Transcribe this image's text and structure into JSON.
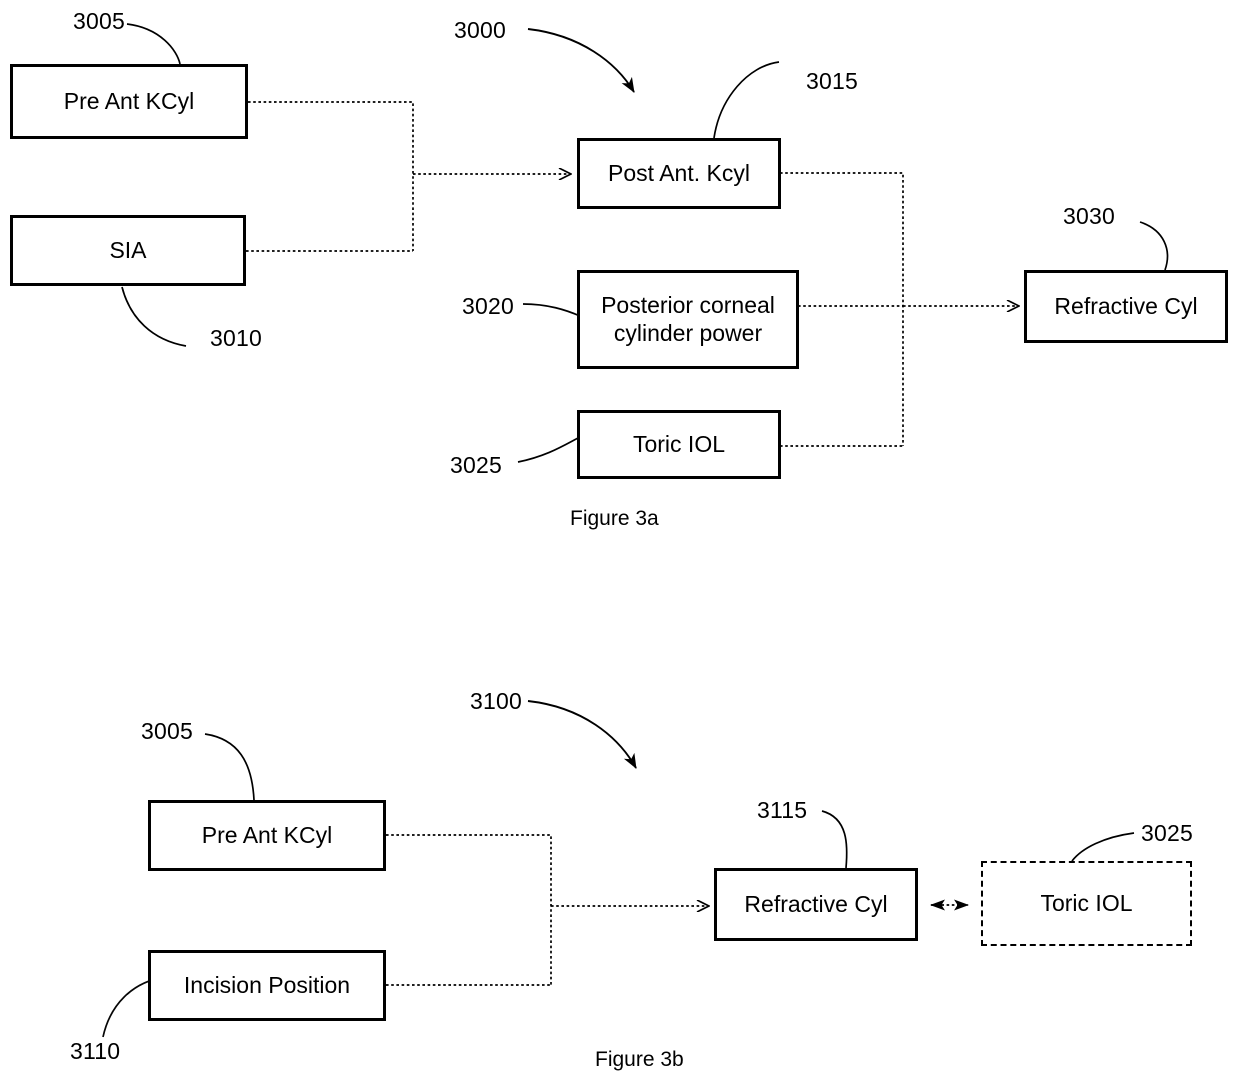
{
  "document": {
    "title": "Patent Figure 3a / 3b - Toric IOL refractive cylinder flow diagrams"
  },
  "figures": [
    {
      "id": "figure-3a",
      "caption": "Figure 3a",
      "overall_ref": "3000",
      "nodes": [
        {
          "id": "pre-ant-kcyl",
          "label": "Pre Ant KCyl",
          "ref": "3005",
          "style": "solid"
        },
        {
          "id": "sia",
          "label": "SIA",
          "ref": "3010",
          "style": "solid"
        },
        {
          "id": "post-ant-kcyl",
          "label": "Post Ant. Kcyl",
          "ref": "3015",
          "style": "solid"
        },
        {
          "id": "posterior-corneal-cylinder-power",
          "label": "Posterior corneal\ncylinder power",
          "ref": "3020",
          "style": "solid"
        },
        {
          "id": "toric-iol",
          "label": "Toric IOL",
          "ref": "3025",
          "style": "solid"
        },
        {
          "id": "refractive-cyl",
          "label": "Refractive Cyl",
          "ref": "3030",
          "style": "solid"
        }
      ]
    },
    {
      "id": "figure-3b",
      "caption": "Figure 3b",
      "overall_ref": "3100",
      "nodes": [
        {
          "id": "pre-ant-kcyl-b",
          "label": "Pre Ant KCyl",
          "ref": "3005",
          "style": "solid"
        },
        {
          "id": "incision-position",
          "label": "Incision Position",
          "ref": "3110",
          "style": "solid"
        },
        {
          "id": "refractive-cyl-b",
          "label": "Refractive Cyl",
          "ref": "3115",
          "style": "solid"
        },
        {
          "id": "toric-iol-b",
          "label": "Toric IOL",
          "ref": "3025",
          "style": "dashed"
        }
      ]
    }
  ],
  "labels": {
    "fig3a": {
      "box_pre_ant_kcyl": "Pre Ant KCyl",
      "box_sia": "SIA",
      "box_post_ant_kcyl": "Post Ant. Kcyl",
      "box_posterior_line1": "Posterior corneal",
      "box_posterior_line2": "cylinder power",
      "box_toric_iol": "Toric IOL",
      "box_refractive_cyl": "Refractive Cyl",
      "ref_3000": "3000",
      "ref_3005": "3005",
      "ref_3010": "3010",
      "ref_3015": "3015",
      "ref_3020": "3020",
      "ref_3025": "3025",
      "ref_3030": "3030",
      "caption": "Figure 3a"
    },
    "fig3b": {
      "box_pre_ant_kcyl": "Pre Ant KCyl",
      "box_incision_position": "Incision Position",
      "box_refractive_cyl": "Refractive Cyl",
      "box_toric_iol": "Toric IOL",
      "ref_3100": "3100",
      "ref_3005": "3005",
      "ref_3110": "3110",
      "ref_3115": "3115",
      "ref_3025": "3025",
      "caption": "Figure 3b"
    }
  },
  "colors": {
    "line": "#000000",
    "background": "#ffffff",
    "text": "#000000"
  }
}
